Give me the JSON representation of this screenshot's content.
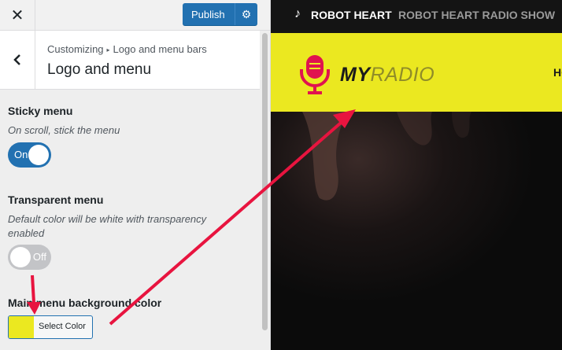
{
  "topbar": {
    "close_icon": "close-icon",
    "publish_label": "Publish",
    "publish_settings_icon": "gear-icon"
  },
  "section": {
    "breadcrumb_root": "Customizing",
    "breadcrumb_sep": "▸",
    "breadcrumb_parent": "Logo and menu bars",
    "title": "Logo and menu",
    "back_icon": "chevron-left-icon"
  },
  "controls": {
    "sticky": {
      "title": "Sticky menu",
      "description": "On scroll, stick the menu",
      "toggle_label": "On",
      "value": true
    },
    "transparent": {
      "title": "Transparent menu",
      "description": "Default color will be white with transparency enabled",
      "toggle_label": "Off",
      "value": false
    },
    "bgcolor": {
      "title": "Main menu background color",
      "button_label": "Select Color",
      "value": "#ebe820"
    }
  },
  "preview": {
    "ticker_title": "ROBOT HEART",
    "ticker_subtitle": "ROBOT HEART RADIO SHOW",
    "brand_my": "MY",
    "brand_radio": "RADIO",
    "nav_cut_text": "HO"
  },
  "colors": {
    "accent": "#2271b1",
    "menu_bg": "#ebe820",
    "brand_pink": "#e0134f",
    "annotation": "#e8143f"
  }
}
